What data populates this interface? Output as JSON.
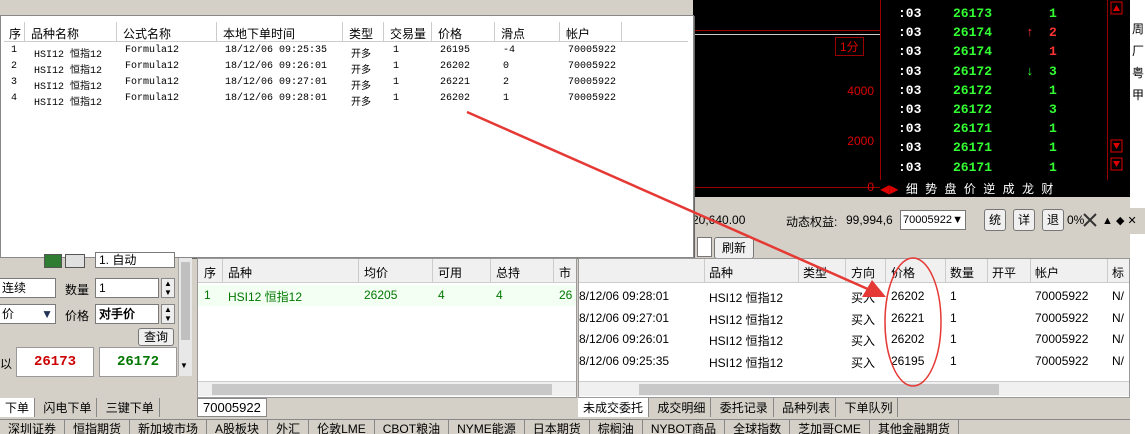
{
  "chart": {
    "y_labels": [
      "4000",
      "2000",
      "0"
    ],
    "period_label": "1分"
  },
  "ticks": [
    {
      "time": ":03",
      "price": "26173",
      "arrow": "",
      "vol": "1",
      "vol_color": "green"
    },
    {
      "time": ":03",
      "price": "26174",
      "arrow": "↑",
      "vol": "2",
      "vol_color": "red"
    },
    {
      "time": ":03",
      "price": "26174",
      "arrow": "",
      "vol": "1",
      "vol_color": "red"
    },
    {
      "time": ":03",
      "price": "26172",
      "arrow": "↓",
      "vol": "3",
      "vol_color": "green"
    },
    {
      "time": ":03",
      "price": "26172",
      "arrow": "",
      "vol": "1",
      "vol_color": "green"
    },
    {
      "time": ":03",
      "price": "26172",
      "arrow": "",
      "vol": "3",
      "vol_color": "green"
    },
    {
      "time": ":03",
      "price": "26171",
      "arrow": "",
      "vol": "1",
      "vol_color": "green"
    },
    {
      "time": ":03",
      "price": "26171",
      "arrow": "",
      "vol": "1",
      "vol_color": "green"
    },
    {
      "time": ":03",
      "price": "26171",
      "arrow": "",
      "vol": "1",
      "vol_color": "green"
    }
  ],
  "tick_tabs": [
    "细",
    "势",
    "盘",
    "价",
    "逆",
    "成",
    "龙",
    "财"
  ],
  "right_edge_chars": [
    "周",
    "厂",
    "粤",
    "甲"
  ],
  "account_bar": {
    "equity_prefix": "20,640.00",
    "dynamic_equity_label": "动态权益:",
    "dynamic_equity_value": "99,994,6",
    "account_select": "70005922",
    "btn_stats": "统",
    "btn_detail": "详",
    "btn_exit": "退",
    "trailing": "0%",
    "refresh": "刷新"
  },
  "popup": {
    "headers": [
      "序",
      "品种名称",
      "公式名称",
      "本地下单时间",
      "类型",
      "交易量",
      "价格",
      "滑点",
      "帐户"
    ],
    "rows": [
      {
        "seq": "1",
        "name": "HSI12 恒指12",
        "formula": "Formula12",
        "time": "18/12/06 09:25:35",
        "type": "开多",
        "qty": "1",
        "price": "26195",
        "slip": "-4",
        "acct": "70005922"
      },
      {
        "seq": "2",
        "name": "HSI12 恒指12",
        "formula": "Formula12",
        "time": "18/12/06 09:26:01",
        "type": "开多",
        "qty": "1",
        "price": "26202",
        "slip": "0",
        "acct": "70005922"
      },
      {
        "seq": "3",
        "name": "HSI12 恒指12",
        "formula": "Formula12",
        "time": "18/12/06 09:27:01",
        "type": "开多",
        "qty": "1",
        "price": "26221",
        "slip": "2",
        "acct": "70005922"
      },
      {
        "seq": "4",
        "name": "HSI12 恒指12",
        "formula": "Formula12",
        "time": "18/12/06 09:28:01",
        "type": "开多",
        "qty": "1",
        "price": "26202",
        "slip": "1",
        "acct": "70005922"
      }
    ]
  },
  "order_panel": {
    "mode_value": "1. 自动",
    "open_type": "连续",
    "qty_label": "数量",
    "qty_value": "1",
    "price_type": "价",
    "price_label": "价格",
    "price_value": "对手价",
    "query_button": "查询",
    "side_label": "以",
    "bid_price": "26173",
    "ask_price": "26172"
  },
  "positions": {
    "headers": [
      "序",
      "品种",
      "均价",
      "可用",
      "总持",
      "市"
    ],
    "rows": [
      {
        "seq": "1",
        "name": "HSI12 恒指12",
        "avg": "26205",
        "avail": "4",
        "total": "4",
        "mkt": "26"
      }
    ],
    "account_tab": "70005922"
  },
  "deals": {
    "headers": [
      "品种",
      "类型",
      "方向",
      "价格",
      "数量",
      "开平",
      "帐户",
      "标"
    ],
    "rows": [
      {
        "time": "8/12/06 09:28:01",
        "name": "HSI12 恒指12",
        "type": "",
        "dir": "买入",
        "price": "26202",
        "qty": "1",
        "oc": "",
        "acct": "70005922",
        "tag": "N/"
      },
      {
        "time": "8/12/06 09:27:01",
        "name": "HSI12 恒指12",
        "type": "",
        "dir": "买入",
        "price": "26221",
        "qty": "1",
        "oc": "",
        "acct": "70005922",
        "tag": "N/"
      },
      {
        "time": "8/12/06 09:26:01",
        "name": "HSI12 恒指12",
        "type": "",
        "dir": "买入",
        "price": "26202",
        "qty": "1",
        "oc": "",
        "acct": "70005922",
        "tag": "N/"
      },
      {
        "time": "8/12/06 09:25:35",
        "name": "HSI12 恒指12",
        "type": "",
        "dir": "买入",
        "price": "26195",
        "qty": "1",
        "oc": "",
        "acct": "70005922",
        "tag": "N/"
      }
    ],
    "tabs": [
      "未成交委托",
      "成交明细",
      "委托记录",
      "品种列表",
      "下单队列"
    ]
  },
  "left_tabs": [
    "下单",
    "闪电下单",
    "三键下单"
  ],
  "bottom_bar": [
    "深圳证券",
    "恒指期货",
    "新加坡市场",
    "A股板块",
    "外汇",
    "伦敦LME",
    "CBOT粮油",
    "NYME能源",
    "日本期货",
    "棕榈油",
    "NYBOT商品",
    "全球指数",
    "芝加哥CME",
    "其他金融期货"
  ],
  "colors": {
    "red_price": "#cc0000",
    "green_price": "#007700",
    "tick_green": "#33ff33",
    "annotation_red": "#e53935"
  }
}
